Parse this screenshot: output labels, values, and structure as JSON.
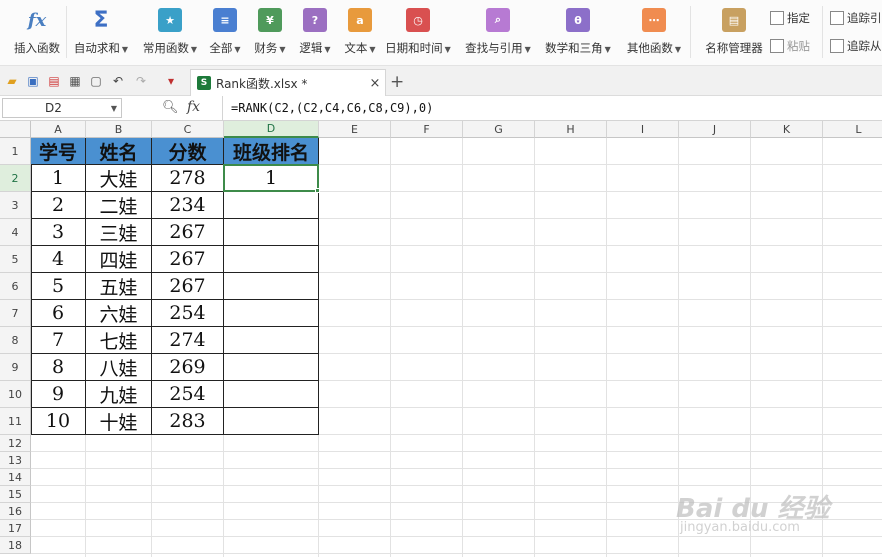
{
  "ribbon": {
    "buttons": [
      {
        "label": "插入函数",
        "icon": "fx-icon",
        "glyph": "fx",
        "color": "#4a7fc1"
      },
      {
        "label": "自动求和",
        "icon": "sigma-icon",
        "glyph": "Σ",
        "color": "#3d6fc4"
      },
      {
        "label": "常用函数",
        "icon": "star-book-icon",
        "glyph": "★",
        "color": "#3aa0c8"
      },
      {
        "label": "全部",
        "icon": "list-book-icon",
        "glyph": "≡",
        "color": "#4a7fd1"
      },
      {
        "label": "财务",
        "icon": "finance-book-icon",
        "glyph": "¥",
        "color": "#4f9a5b"
      },
      {
        "label": "逻辑",
        "icon": "logic-book-icon",
        "glyph": "?",
        "color": "#9b6fc1"
      },
      {
        "label": "文本",
        "icon": "text-book-icon",
        "glyph": "a",
        "color": "#e89a3c"
      },
      {
        "label": "日期和时间",
        "icon": "clock-book-icon",
        "glyph": "◷",
        "color": "#d95050"
      },
      {
        "label": "查找与引用",
        "icon": "search-book-icon",
        "glyph": "⌕",
        "color": "#b77ad3"
      },
      {
        "label": "数学和三角",
        "icon": "theta-book-icon",
        "glyph": "θ",
        "color": "#8c6fc9"
      },
      {
        "label": "其他函数",
        "icon": "more-book-icon",
        "glyph": "⋯",
        "color": "#f08c50"
      },
      {
        "label": "名称管理器",
        "icon": "name-manager-icon",
        "glyph": "▤",
        "color": "#c8a060"
      }
    ],
    "small": {
      "specify": "指定",
      "paste": "粘贴",
      "trace_precedents": "追踪引",
      "trace_dependents": "追踪从"
    }
  },
  "tabbar": {
    "doc_name": "Rank函数.xlsx *",
    "close": "×",
    "new_tab": "+"
  },
  "formula_bar": {
    "name_box": "D2",
    "fx": "fx",
    "formula": "=RANK(C2,(C2,C4,C6,C8,C9),0)"
  },
  "grid": {
    "columns": [
      "A",
      "B",
      "C",
      "D",
      "E",
      "F",
      "G",
      "H",
      "I",
      "J",
      "K",
      "L"
    ],
    "rows": [
      "1",
      "2",
      "3",
      "4",
      "5",
      "6",
      "7",
      "8",
      "9",
      "10",
      "11",
      "12",
      "13",
      "14",
      "15",
      "16",
      "17",
      "18"
    ],
    "selected_column": "D",
    "selected_row": "2",
    "header": [
      "学号",
      "姓名",
      "分数",
      "班级排名"
    ],
    "data": [
      [
        "1",
        "大娃",
        "278",
        "1"
      ],
      [
        "2",
        "二娃",
        "234",
        ""
      ],
      [
        "3",
        "三娃",
        "267",
        ""
      ],
      [
        "4",
        "四娃",
        "267",
        ""
      ],
      [
        "5",
        "五娃",
        "267",
        ""
      ],
      [
        "6",
        "六娃",
        "254",
        ""
      ],
      [
        "7",
        "七娃",
        "274",
        ""
      ],
      [
        "8",
        "八娃",
        "269",
        ""
      ],
      [
        "9",
        "九娃",
        "254",
        ""
      ],
      [
        "10",
        "十娃",
        "283",
        ""
      ]
    ]
  },
  "colors": {
    "header_fill": "#4a90d1",
    "selection": "#3d8b4a"
  }
}
